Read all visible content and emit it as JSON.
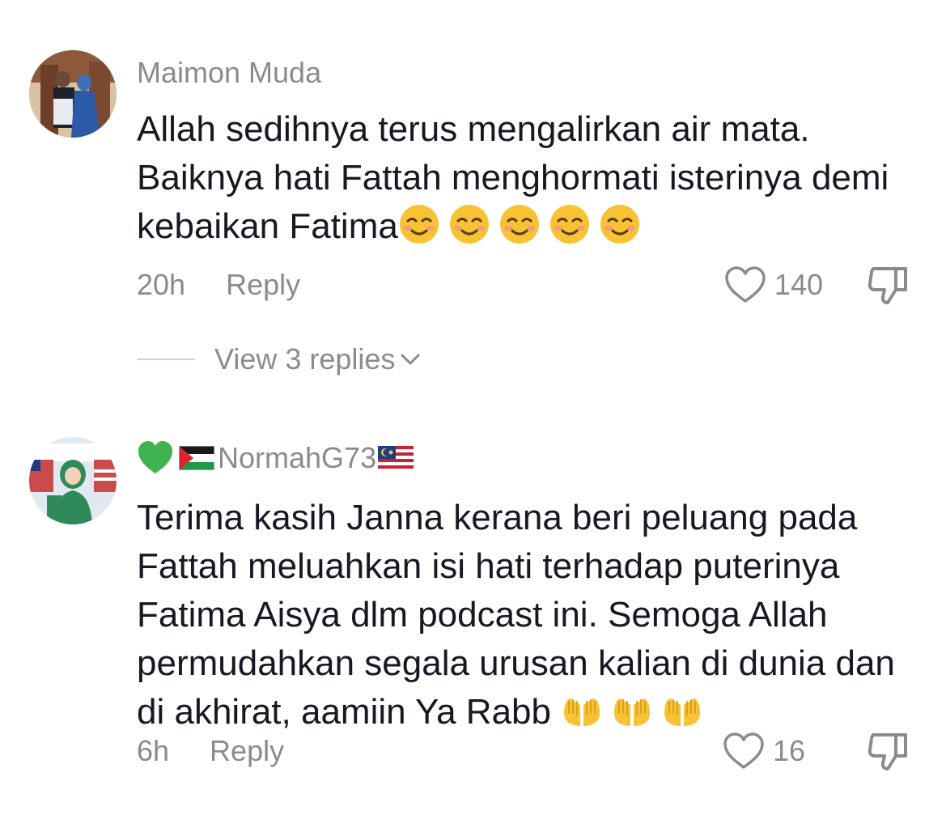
{
  "comments": [
    {
      "username": "Maimon Muda",
      "body_text": "Allah sedihnya terus mengalirkan air mata. Baiknya hati Fattah menghormati isterinya demi kebaikan Fatima",
      "body_emojis": [
        "smiling-face",
        "smiling-face",
        "smiling-face",
        "smiling-face",
        "smiling-face"
      ],
      "time": "20h",
      "reply_label": "Reply",
      "like_count": "140",
      "view_replies_label": "View 3 replies"
    },
    {
      "username": "NormahG73",
      "username_prefix_icons": [
        "green-heart",
        "palestine-flag"
      ],
      "username_suffix_icons": [
        "malaysia-flag"
      ],
      "body_text": "Terima kasih Janna kerana beri peluang pada Fattah meluahkan isi hati terhadap puterinya Fatima Aisya dlm podcast ini. Semoga Allah permudahkan segala urusan kalian di dunia dan di akhirat, aamiin Ya Rabb",
      "body_emojis": [
        "open-hands",
        "open-hands",
        "open-hands"
      ],
      "time": "6h",
      "reply_label": "Reply",
      "like_count": "16"
    }
  ],
  "colors": {
    "text_primary": "#161823",
    "text_secondary": "#8a8b91",
    "emoji_yellow": "#f7c234"
  }
}
